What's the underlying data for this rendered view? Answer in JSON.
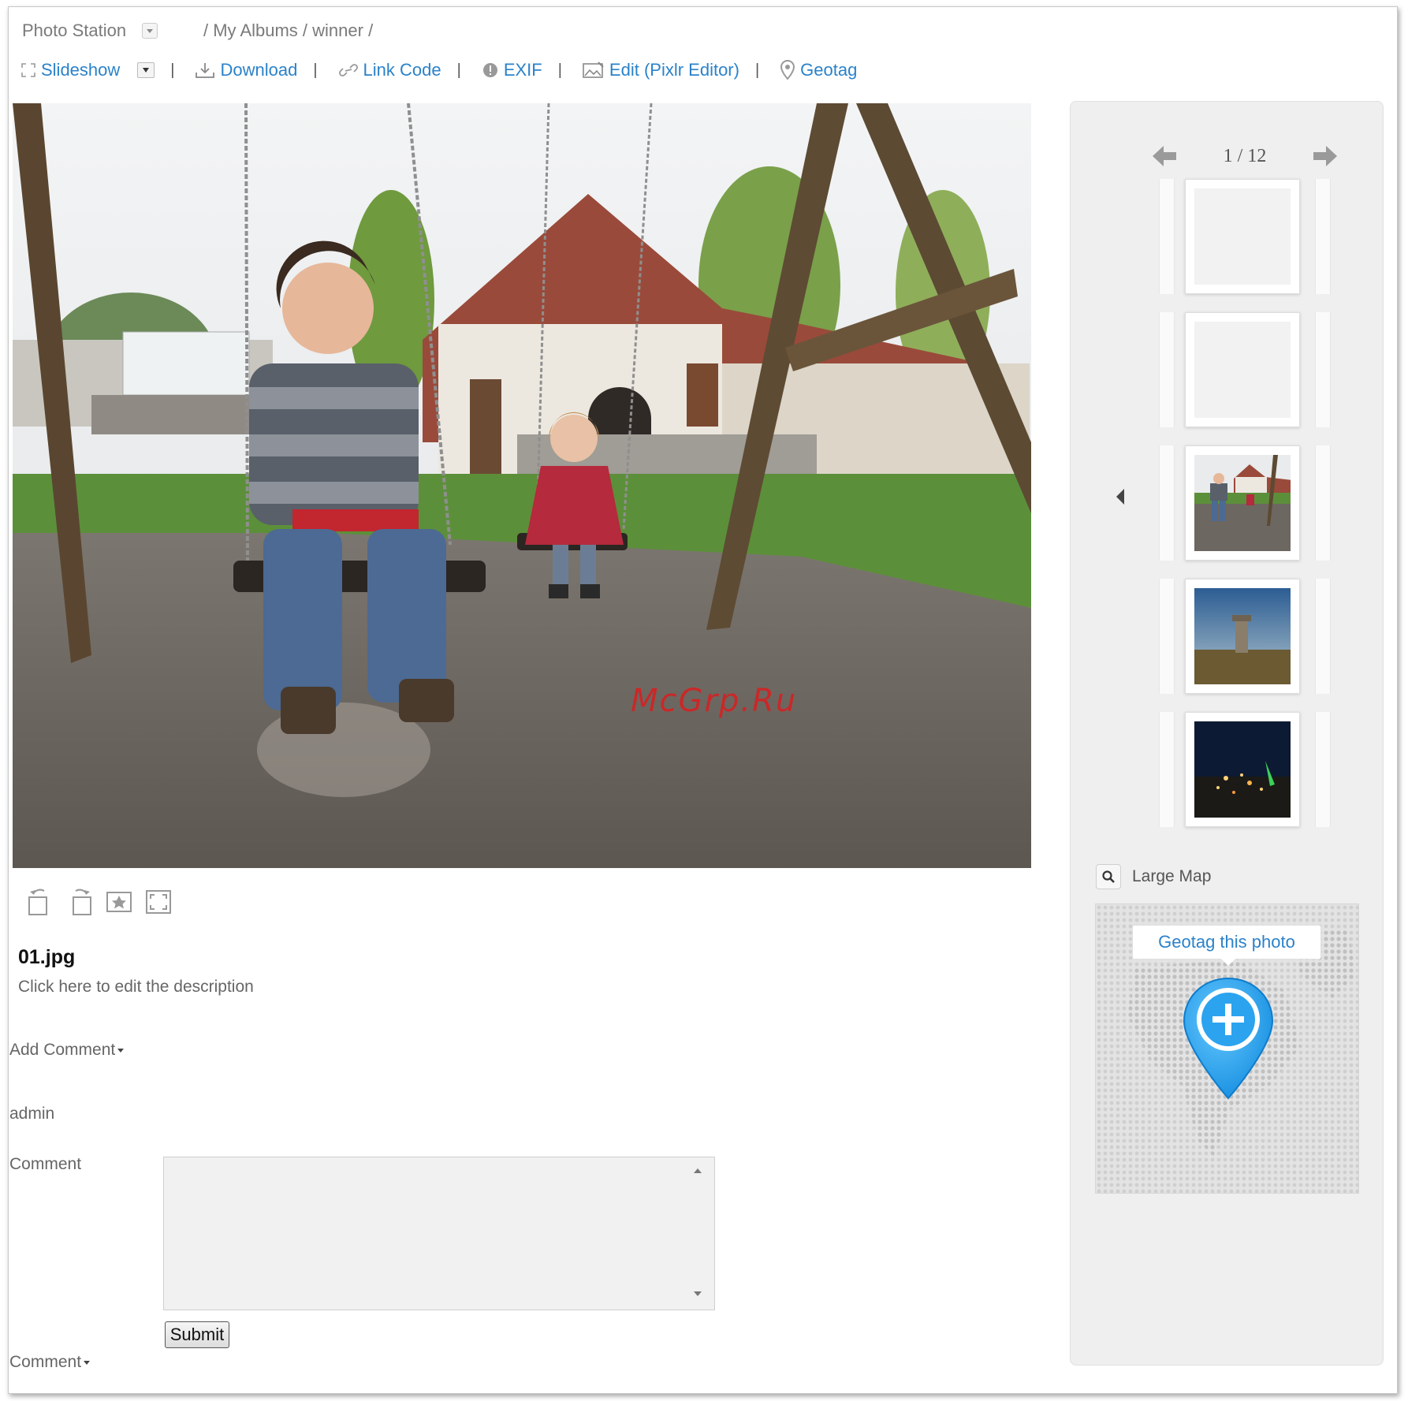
{
  "app": {
    "title": "Photo Station",
    "breadcrumb": "/ My Albums / winner /"
  },
  "toolbar": {
    "slideshow": "Slideshow",
    "download": "Download",
    "link_code": "Link Code",
    "exif": "EXIF",
    "edit": "Edit (Pixlr Editor)",
    "geotag": "Geotag",
    "separator": "|"
  },
  "photo": {
    "watermark": "McGrp.Ru",
    "file_name": "01.jpg",
    "description": "Click here to edit the description"
  },
  "comments": {
    "add_comment": "Add Comment",
    "user": "admin",
    "comment_label": "Comment",
    "comment_value": "",
    "submit": "Submit",
    "footer": "Comment"
  },
  "sidebar": {
    "counter": "1 / 12",
    "large_map": "Large Map",
    "geotag_this_photo": "Geotag this photo"
  },
  "colors": {
    "link": "#2b82c9",
    "pin": "#1f9be8"
  }
}
